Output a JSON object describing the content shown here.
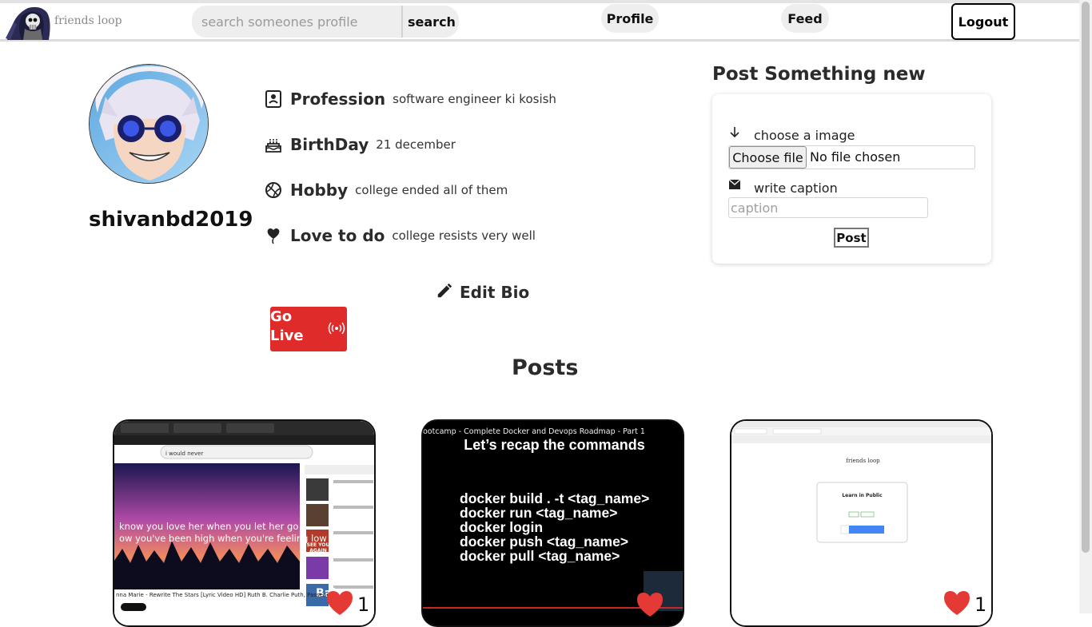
{
  "navbar": {
    "logo_text": "friends loop",
    "search_placeholder": "search someones profile",
    "search_button": "search",
    "profile_link": "Profile",
    "feed_link": "Feed",
    "logout_button": "Logout"
  },
  "profile": {
    "username": "shivanbd2019",
    "bio": [
      {
        "icon": "id-card-icon",
        "label": "Profession",
        "value": "software engineer ki kosish"
      },
      {
        "icon": "cake-icon",
        "label": "BirthDay",
        "value": "21 december"
      },
      {
        "icon": "basketball-icon",
        "label": "Hobby",
        "value": "college ended all of them"
      },
      {
        "icon": "balloon-icon",
        "label": "Love to do",
        "value": "college resists very well"
      }
    ],
    "edit_bio": "Edit Bio",
    "go_live": "Go Live"
  },
  "post_form": {
    "title": "Post Something new",
    "image_label": "choose a image",
    "choose_file": "Choose file",
    "no_file": "No file chosen",
    "caption_label": "write caption",
    "caption_placeholder": "caption",
    "post_button": "Post"
  },
  "posts": {
    "heading": "Posts",
    "items": [
      {
        "likes": "1",
        "lyric_1": "know you love her when you let her go",
        "lyric_2": "ow you've been high when you're feeling low",
        "video_title": "nna Marie - Rewrite The Stars [Lyric Video HD] Ruth B. Charlie Puth, Passenger",
        "search_text": "i would never",
        "thumb_text": "SEE YOU AGAIN",
        "thumb_text_2": "Bab"
      },
      {
        "likes": "",
        "video_title": "ootcamp - Complete Docker and Devops Roadmap - Part 1",
        "slide_title": "Let’s recap the commands",
        "commands": [
          "docker build . -t <tag_name>",
          "docker run <tag_name>",
          "docker login",
          "docker push <tag_name>",
          "docker pull <tag_name>"
        ]
      },
      {
        "likes": "1",
        "site_title": "friends loop",
        "card_title": "Learn in Public"
      }
    ]
  },
  "colors": {
    "accent_red": "#e02b2b",
    "heart_red": "#e53935",
    "nav_pill_bg": "#eeeeee"
  }
}
